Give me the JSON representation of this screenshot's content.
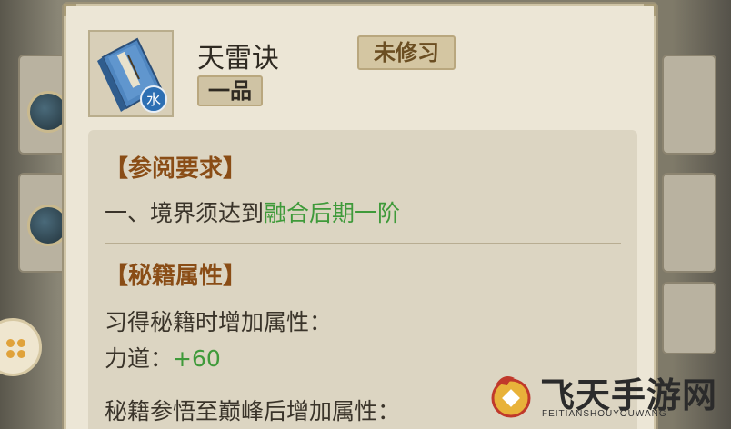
{
  "skill": {
    "name": "天雷诀",
    "status_badge": "未修习",
    "grade_badge": "一品",
    "element_tag": "水"
  },
  "requirements": {
    "title": "【参阅要求】",
    "prefix": "一、境界须达到",
    "realm": "融合后期一阶"
  },
  "attributes": {
    "title": "【秘籍属性】",
    "learn_label": "习得秘籍时增加属性：",
    "stat_label": "力道：",
    "stat_value": "+60",
    "peak_label": "秘籍参悟至巅峰后增加属性："
  },
  "watermark": {
    "title": "飞天手游网",
    "subtitle": "FEITIANSHOUYOUWANG"
  },
  "colors": {
    "accent_brown": "#8a4d16",
    "value_green": "#3f9a3a",
    "panel_bg": "#ece6d6"
  },
  "icons": [
    "skill-book-icon",
    "element-water-icon",
    "menu-dots-icon",
    "watermark-logo-icon"
  ]
}
